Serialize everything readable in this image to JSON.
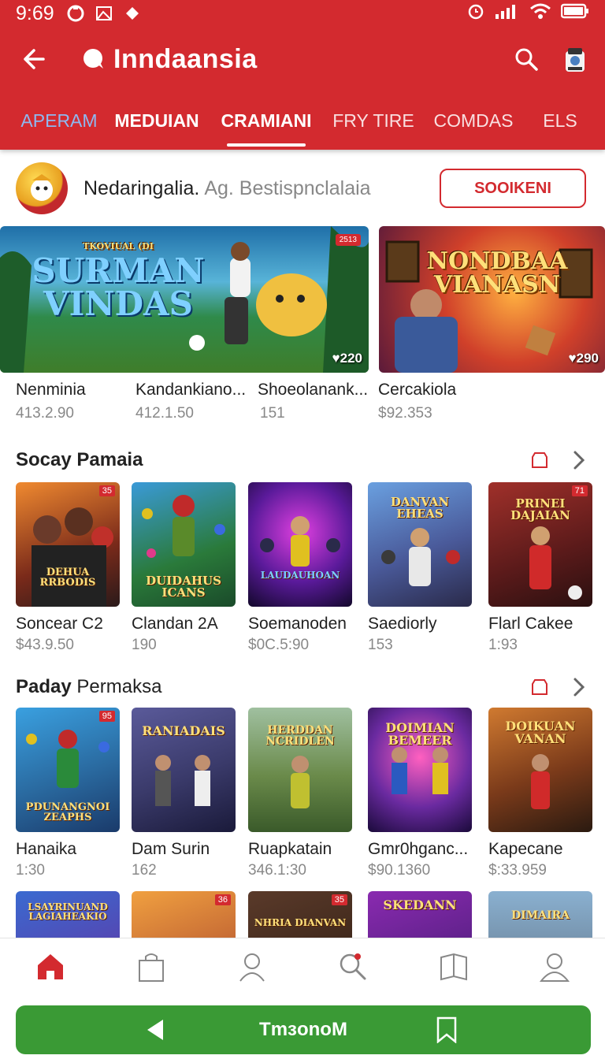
{
  "status_bar": {
    "time": "9:69"
  },
  "header": {
    "title": "Inndaansia",
    "tabs": [
      {
        "label": "APERAM"
      },
      {
        "label": "MEDUIAN"
      },
      {
        "label": "CRAMIANI"
      },
      {
        "label": "FRY TIRE"
      },
      {
        "label": "COMDAS"
      },
      {
        "label": "ELS"
      }
    ],
    "active_tab": "CRAMIANI"
  },
  "channel": {
    "name": "Nedaringalia.",
    "subtitle": "Ag. Bestispnclalaia",
    "follow_label": "SOOIKENI"
  },
  "featured": [
    {
      "art_title": "SURMAN VINDAS",
      "art_subtitle": "TKOVIUAL (DI",
      "badge": "2513",
      "count": "♥220",
      "name": "Nenminia",
      "meta": "413.2.90"
    },
    {
      "name": "Kandankiano...",
      "meta": "412.1.50"
    },
    {
      "name": "Shoeolanank...",
      "meta": "151"
    },
    {
      "art_title": "NONDBAA VIANASN",
      "count": "♥290",
      "name": "Cercakiola",
      "meta": "$92.353"
    }
  ],
  "sections": [
    {
      "title_bold": "Socay Pamaia",
      "title_rest": "",
      "items": [
        {
          "art_title": "DEHUA RRBODIS",
          "badge": "35",
          "name": "Soncear C2",
          "meta": "$43.9.50"
        },
        {
          "art_title": "DUIDAHUS ICANS",
          "badge": "",
          "name": "Clandan 2A",
          "meta": "190"
        },
        {
          "art_title": "LAUDAUHOAN",
          "badge": "",
          "name": "Soemanoden",
          "meta": "$0C.5:90"
        },
        {
          "art_title": "DANVAN EHEAS",
          "badge": "",
          "name": "Saediorly",
          "meta": "153"
        },
        {
          "art_title": "PRINEI DAJAIAN",
          "badge": "71",
          "name": "Flarl Cakee",
          "meta": "1:93"
        }
      ]
    },
    {
      "title_bold": "Paday",
      "title_rest": "Permaksa",
      "items": [
        {
          "art_title": "PDUNANGNOI ZEAPHS",
          "badge": "95",
          "name": "Hanaika",
          "meta": "1:30"
        },
        {
          "art_title": "RANIADAIS",
          "badge": "",
          "name": "Dam Surin",
          "meta": "162"
        },
        {
          "art_title": "HERDDAN NCRIDLEN",
          "badge": "",
          "name": "Ruapkatain",
          "meta": "346.1:30"
        },
        {
          "art_title": "DOIMIAN BEMEER",
          "badge": "",
          "name": "Gmr0hganc...",
          "meta": "$90.1360"
        },
        {
          "art_title": "DOIKUAN VANAN",
          "badge": "",
          "name": "Kapecane",
          "meta": "$:33.959"
        }
      ]
    }
  ],
  "peek_row": [
    {
      "art_title": "LSAYRINUAND LAGIAHEAKIO",
      "badge": ""
    },
    {
      "art_title": "",
      "badge": "36"
    },
    {
      "art_title": "NHRIA DIANVAN",
      "badge": "35"
    },
    {
      "art_title": "SKEDANN",
      "badge": ""
    },
    {
      "art_title": "DIMAIRA",
      "badge": ""
    }
  ],
  "cta": {
    "label": "TmɜonoM"
  },
  "colors": {
    "brand_red": "#d32a2f",
    "cta_green": "#3a9a35"
  }
}
